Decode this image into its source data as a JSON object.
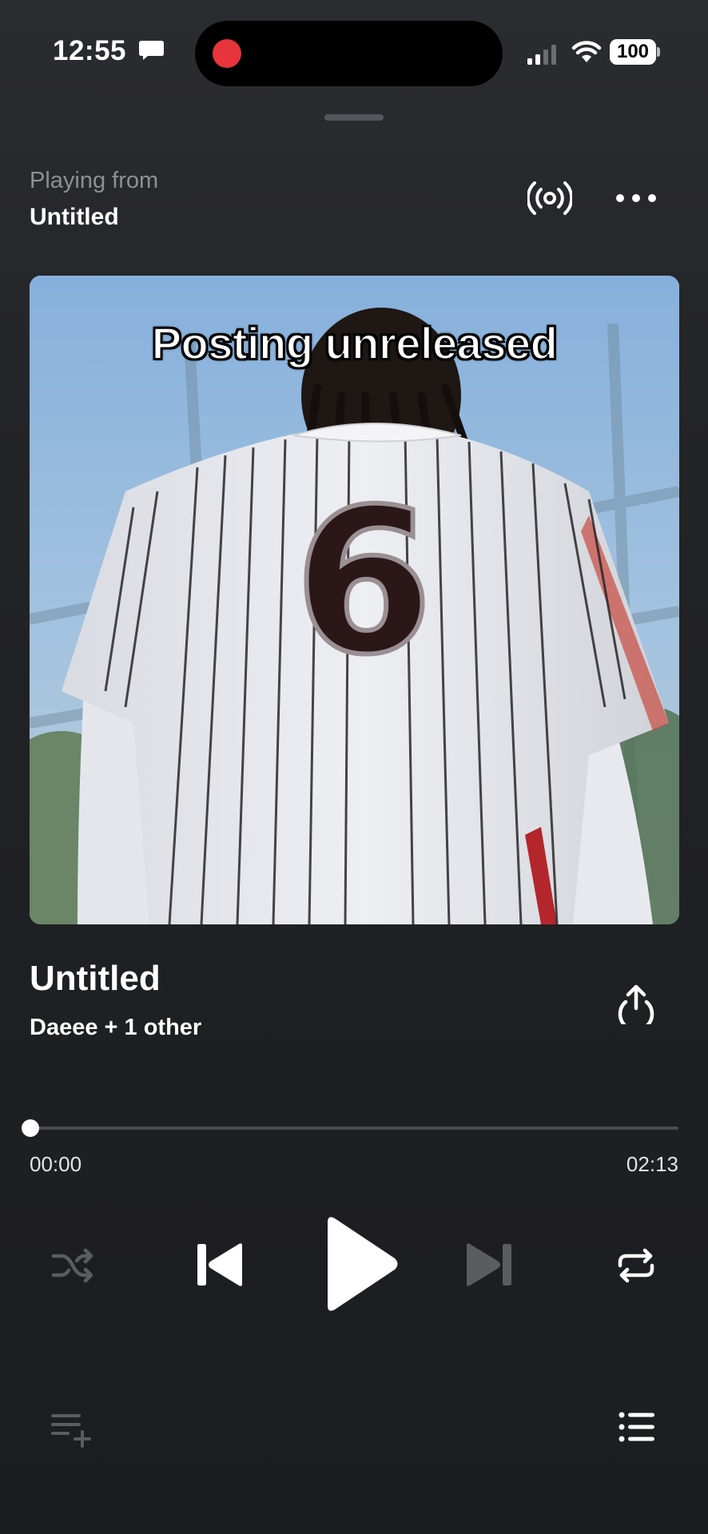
{
  "status_bar": {
    "time": "12:55",
    "battery": "100"
  },
  "header": {
    "playing_from_label": "Playing from",
    "playing_from_title": "Untitled"
  },
  "artwork": {
    "caption": "Posting unreleased",
    "jersey_number": "6"
  },
  "track": {
    "title": "Untitled",
    "artist": "Daeee + 1 other"
  },
  "progress": {
    "elapsed": "00:00",
    "total": "02:13",
    "fraction": 0
  },
  "controls": {
    "shuffle_icon": "shuffle-icon",
    "previous_icon": "skip-previous-icon",
    "play_icon": "play-icon",
    "next_icon": "skip-next-icon",
    "repeat_icon": "repeat-icon"
  },
  "footer": {
    "add_to_queue_icon": "add-to-queue-icon",
    "queue_icon": "queue-list-icon"
  },
  "colors": {
    "background": "#1c1d20",
    "accent_record": "#e8343c",
    "muted_text": "#8d8f94",
    "disabled_icon": "#5a5c60"
  }
}
